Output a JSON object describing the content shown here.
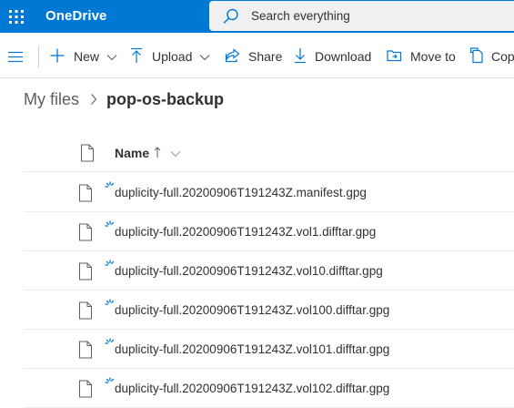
{
  "app": {
    "title": "OneDrive",
    "brand_color": "#0078d4"
  },
  "search": {
    "placeholder": "Search everything",
    "icon": "search-icon"
  },
  "command_bar": {
    "new_label": "New",
    "upload_label": "Upload",
    "share_label": "Share",
    "download_label": "Download",
    "move_to_label": "Move to",
    "copy_to_label": "Cop"
  },
  "breadcrumb": {
    "root": "My files",
    "current": "pop-os-backup"
  },
  "list": {
    "column_name": "Name",
    "sort": "ascending",
    "files": [
      {
        "name": "duplicity-full.20200906T191243Z.manifest.gpg",
        "status": "syncing"
      },
      {
        "name": "duplicity-full.20200906T191243Z.vol1.difftar.gpg",
        "status": "syncing"
      },
      {
        "name": "duplicity-full.20200906T191243Z.vol10.difftar.gpg",
        "status": "syncing"
      },
      {
        "name": "duplicity-full.20200906T191243Z.vol100.difftar.gpg",
        "status": "syncing"
      },
      {
        "name": "duplicity-full.20200906T191243Z.vol101.difftar.gpg",
        "status": "syncing"
      },
      {
        "name": "duplicity-full.20200906T191243Z.vol102.difftar.gpg",
        "status": "syncing"
      }
    ]
  }
}
